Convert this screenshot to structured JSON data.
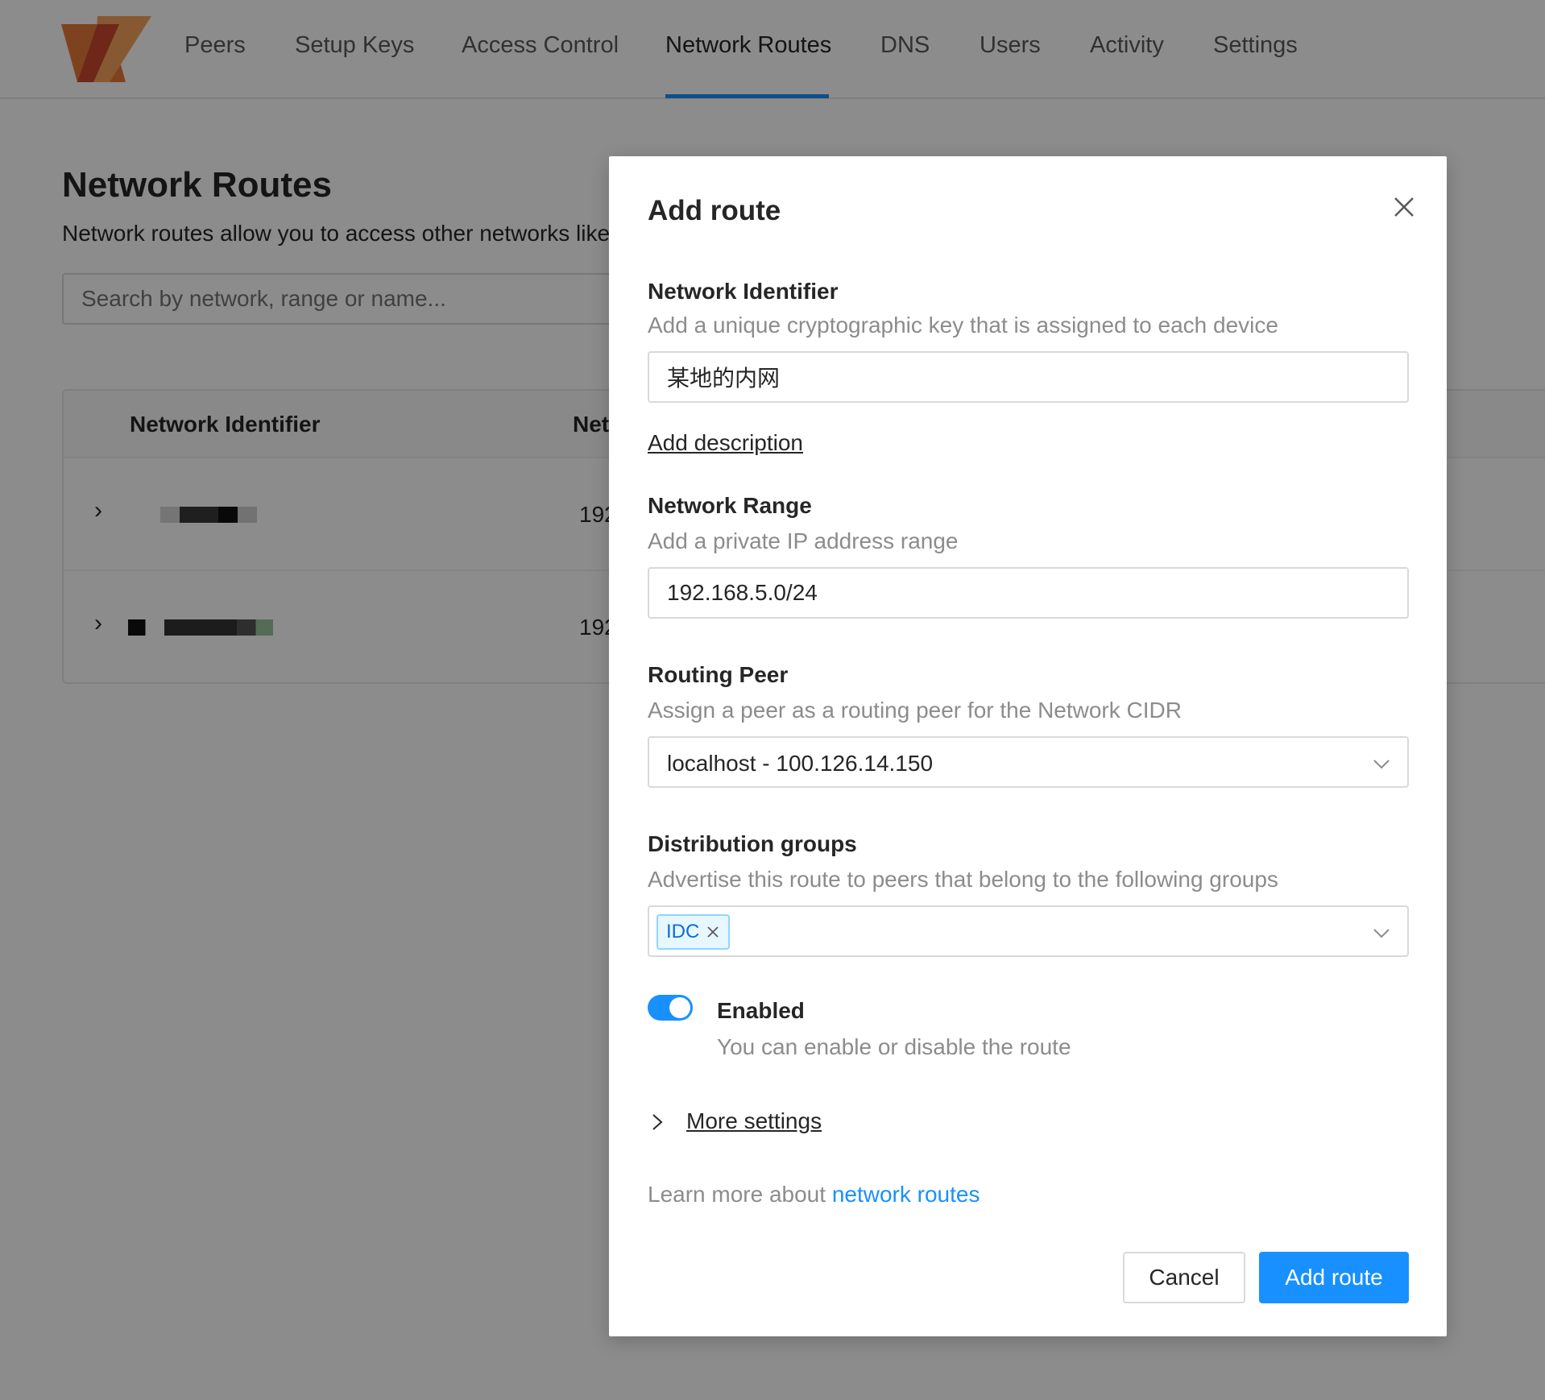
{
  "nav": {
    "items": [
      "Peers",
      "Setup Keys",
      "Access Control",
      "Network Routes",
      "DNS",
      "Users",
      "Activity",
      "Settings"
    ],
    "active": "Network Routes"
  },
  "page": {
    "title": "Network Routes",
    "description": "Network routes allow you to access other networks like"
  },
  "search": {
    "placeholder": "Search by network, range or name..."
  },
  "table": {
    "headers": [
      "Network Identifier",
      "Net"
    ],
    "rows": [
      {
        "range": "192"
      },
      {
        "range": "192"
      }
    ]
  },
  "modal": {
    "title": "Add route",
    "network_identifier": {
      "label": "Network Identifier",
      "help": "Add a unique cryptographic key that is assigned to each device",
      "value": "某地的内网"
    },
    "add_description": "Add description",
    "network_range": {
      "label": "Network Range",
      "help": "Add a private IP address range",
      "value": "192.168.5.0/24"
    },
    "routing_peer": {
      "label": "Routing Peer",
      "help": "Assign a peer as a routing peer for the Network CIDR",
      "value": "localhost - 100.126.14.150"
    },
    "distribution_groups": {
      "label": "Distribution groups",
      "help": "Advertise this route to peers that belong to the following groups",
      "tags": [
        "IDC"
      ]
    },
    "enabled": {
      "on": true,
      "label": "Enabled",
      "help": "You can enable or disable the route"
    },
    "more_settings": "More settings",
    "learn_more": {
      "prefix": "Learn more about ",
      "link": "network routes"
    },
    "buttons": {
      "cancel": "Cancel",
      "submit": "Add route"
    }
  },
  "colors": {
    "accent": "#1890ff",
    "logo_orange": "#f08a3c",
    "logo_red": "#d94a2a"
  }
}
